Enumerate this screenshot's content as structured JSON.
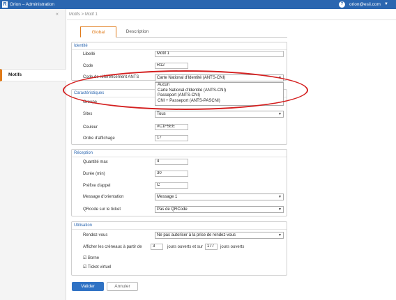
{
  "app": {
    "logo": "R",
    "title": "Orion – Administration",
    "user": "orion@esii.com",
    "help_glyph": "?",
    "caret": "▼"
  },
  "sidebar": {
    "collapse_glyph": "«",
    "items": [
      {
        "label": "Motifs"
      }
    ]
  },
  "breadcrumb": "Motifs > Motif 1",
  "tabs": [
    {
      "label": "Global"
    },
    {
      "label": "Description"
    }
  ],
  "identite": {
    "title": "Identité",
    "libelle_label": "Libellé",
    "libelle_value": "Motif 1",
    "code_label": "Code",
    "code_value": "R12",
    "ants_label": "Code de référencement  ANTS",
    "ants_selected": "Carte National d'Identité (ANTS-CNI)",
    "ants_options": [
      "Aucun",
      "Carte National d'Identité (ANTS-CNI)",
      "Passeport (ANTS-CNI)",
      "CNI  + Passeport (ANTS-PASCNI)"
    ]
  },
  "caracteristiques": {
    "title": "Caractéristiques",
    "groupe_label": "Groupe",
    "sites_label": "Sites",
    "sites_value": "Tous",
    "couleur_label": "Couleur",
    "couleur_value": "#C1F5EE",
    "ordre_label": "Ordre d'affichage",
    "ordre_value": "17"
  },
  "reception": {
    "title": "Réception",
    "quantite_label": "Quantité max",
    "quantite_value": "4",
    "duree_label": "Durée  (min)",
    "duree_value": "30",
    "prefixe_label": "Préfixe d'appel",
    "prefixe_value": "C",
    "message_label": "Message d'orientation",
    "message_value": "Message 1",
    "qrcode_label": "QRcode sur le ticket",
    "qrcode_value": "Pas de QRCode"
  },
  "utilisation": {
    "title": "Utilisation",
    "rdv_label": "Rendez-vous",
    "rdv_value": "Ne pas autoriser à la prise de rendez-vous",
    "creneaux_prefix": "Afficher  les créneaux  à partir  de",
    "creneaux_from": "3",
    "creneaux_mid": "jours ouverts  et sur",
    "creneaux_to": "177",
    "creneaux_suffix": "jours ouverts",
    "borne_label": "☑ Borne",
    "ticket_label": "☑ Ticket virtuel"
  },
  "actions": {
    "validate": "Valider",
    "cancel": "Annuler"
  },
  "colors": {
    "topbar": "#2a66b0",
    "accent": "#e07b1a",
    "primary_button": "#2f72c4",
    "highlight": "#d42020"
  }
}
